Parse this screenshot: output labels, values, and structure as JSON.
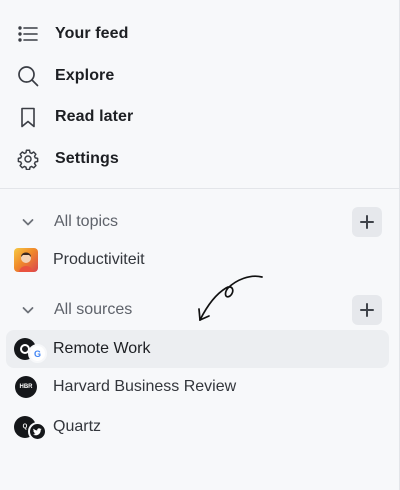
{
  "nav": {
    "feed": {
      "label": "Your feed",
      "icon": "list-icon"
    },
    "explore": {
      "label": "Explore",
      "icon": "search-icon"
    },
    "read_later": {
      "label": "Read later",
      "icon": "bookmark-icon"
    },
    "settings": {
      "label": "Settings",
      "icon": "gear-icon"
    }
  },
  "topics": {
    "header": "All topics",
    "items": [
      {
        "label": "Productiviteit"
      }
    ]
  },
  "sources": {
    "header": "All sources",
    "items": [
      {
        "label": "Remote Work",
        "badge": "G",
        "active": true
      },
      {
        "label": "Harvard Business Review",
        "avatar_text": "HBR"
      },
      {
        "label": "Quartz",
        "avatar_text": "Q"
      }
    ]
  },
  "colors": {
    "background": "#f7f8fa",
    "active_row": "#eceef1",
    "add_button": "#e6e8ec",
    "text_primary": "#1d1f23",
    "text_secondary": "#5e626a",
    "twitter_blue": "#1d9bf0"
  }
}
